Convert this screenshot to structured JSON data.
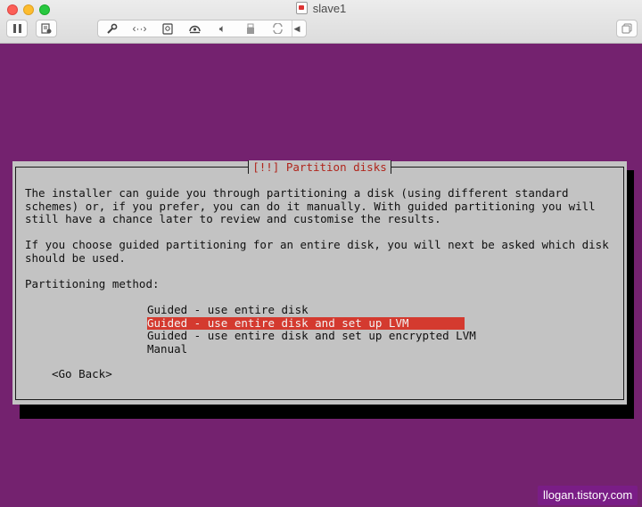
{
  "window": {
    "title": "slave1",
    "toolbar_icons": [
      "pause-icon",
      "snapshot-icon",
      "settings-wrench-icon",
      "network-icon",
      "hard-disk-icon",
      "optical-drive-icon",
      "sound-icon",
      "usb-icon",
      "shared-folder-icon",
      "chevron-left-icon",
      "fullscreen-icon"
    ]
  },
  "installer": {
    "title": "[!!] Partition disks",
    "paragraph1": "The installer can guide you through partitioning a disk (using different standard\nschemes) or, if you prefer, you can do it manually. With guided partitioning you will\nstill have a chance later to review and customise the results.",
    "paragraph2": "If you choose guided partitioning for an entire disk, you will next be asked which disk\nshould be used.",
    "method_label": "Partitioning method:",
    "options": [
      {
        "label": "Guided - use entire disk",
        "selected": false
      },
      {
        "label": "Guided - use entire disk and set up LVM",
        "selected": true
      },
      {
        "label": "Guided - use entire disk and set up encrypted LVM",
        "selected": false
      },
      {
        "label": "Manual",
        "selected": false
      }
    ],
    "go_back": "<Go Back>",
    "colors": {
      "background": "#74226f",
      "dialog": "#c3c3c3",
      "selection": "#d43a2f",
      "title": "#b0251c"
    }
  },
  "watermark": "llogan.tistory.com"
}
